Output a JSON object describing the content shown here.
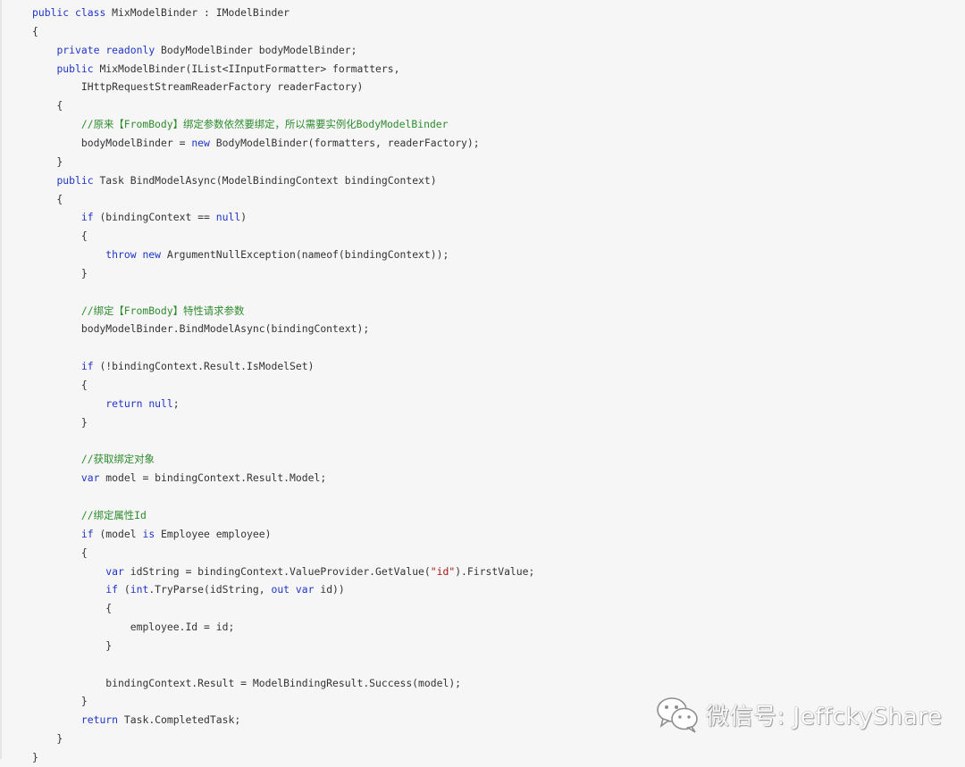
{
  "code": {
    "lines": [
      [
        [
          "kw",
          "public"
        ],
        [
          "p",
          " "
        ],
        [
          "kw",
          "class"
        ],
        [
          "p",
          " MixModelBinder : IModelBinder"
        ]
      ],
      [
        [
          "p",
          "{"
        ]
      ],
      [
        [
          "p",
          "    "
        ],
        [
          "kw",
          "private"
        ],
        [
          "p",
          " "
        ],
        [
          "kw",
          "readonly"
        ],
        [
          "p",
          " BodyModelBinder bodyModelBinder;"
        ]
      ],
      [
        [
          "p",
          "    "
        ],
        [
          "kw",
          "public"
        ],
        [
          "p",
          " MixModelBinder(IList<IInputFormatter> formatters,"
        ]
      ],
      [
        [
          "p",
          "        IHttpRequestStreamReaderFactory readerFactory)"
        ]
      ],
      [
        [
          "p",
          "    {"
        ]
      ],
      [
        [
          "p",
          "        "
        ],
        [
          "cm",
          "//原来【FromBody】绑定参数依然要绑定，所以需要实例化BodyModelBinder"
        ]
      ],
      [
        [
          "p",
          "        bodyModelBinder = "
        ],
        [
          "kw",
          "new"
        ],
        [
          "p",
          " BodyModelBinder(formatters, readerFactory);"
        ]
      ],
      [
        [
          "p",
          "    }"
        ]
      ],
      [
        [
          "p",
          "    "
        ],
        [
          "kw",
          "public"
        ],
        [
          "p",
          " Task BindModelAsync(ModelBindingContext bindingContext)"
        ]
      ],
      [
        [
          "p",
          "    {"
        ]
      ],
      [
        [
          "p",
          "        "
        ],
        [
          "kw",
          "if"
        ],
        [
          "p",
          " (bindingContext == "
        ],
        [
          "kw",
          "null"
        ],
        [
          "p",
          ")"
        ]
      ],
      [
        [
          "p",
          "        {"
        ]
      ],
      [
        [
          "p",
          "            "
        ],
        [
          "kw",
          "throw"
        ],
        [
          "p",
          " "
        ],
        [
          "kw",
          "new"
        ],
        [
          "p",
          " ArgumentNullException(nameof(bindingContext));"
        ]
      ],
      [
        [
          "p",
          "        }"
        ]
      ],
      [],
      [
        [
          "p",
          "        "
        ],
        [
          "cm",
          "//绑定【FromBody】特性请求参数"
        ]
      ],
      [
        [
          "p",
          "        bodyModelBinder.BindModelAsync(bindingContext);"
        ]
      ],
      [],
      [
        [
          "p",
          "        "
        ],
        [
          "kw",
          "if"
        ],
        [
          "p",
          " (!bindingContext.Result.IsModelSet)"
        ]
      ],
      [
        [
          "p",
          "        {"
        ]
      ],
      [
        [
          "p",
          "            "
        ],
        [
          "kw",
          "return"
        ],
        [
          "p",
          " "
        ],
        [
          "kw",
          "null"
        ],
        [
          "p",
          ";"
        ]
      ],
      [
        [
          "p",
          "        }"
        ]
      ],
      [],
      [
        [
          "p",
          "        "
        ],
        [
          "cm",
          "//获取绑定对象"
        ]
      ],
      [
        [
          "p",
          "        "
        ],
        [
          "kw",
          "var"
        ],
        [
          "p",
          " model = bindingContext.Result.Model;"
        ]
      ],
      [],
      [
        [
          "p",
          "        "
        ],
        [
          "cm",
          "//绑定属性Id"
        ]
      ],
      [
        [
          "p",
          "        "
        ],
        [
          "kw",
          "if"
        ],
        [
          "p",
          " (model "
        ],
        [
          "kw",
          "is"
        ],
        [
          "p",
          " Employee employee)"
        ]
      ],
      [
        [
          "p",
          "        {"
        ]
      ],
      [
        [
          "p",
          "            "
        ],
        [
          "kw",
          "var"
        ],
        [
          "p",
          " idString = bindingContext.ValueProvider.GetValue("
        ],
        [
          "str",
          "\"id\""
        ],
        [
          "p",
          ").FirstValue;"
        ]
      ],
      [
        [
          "p",
          "            "
        ],
        [
          "kw",
          "if"
        ],
        [
          "p",
          " ("
        ],
        [
          "kw",
          "int"
        ],
        [
          "p",
          ".TryParse(idString, "
        ],
        [
          "kw",
          "out"
        ],
        [
          "p",
          " "
        ],
        [
          "kw",
          "var"
        ],
        [
          "p",
          " id))"
        ]
      ],
      [
        [
          "p",
          "            {"
        ]
      ],
      [
        [
          "p",
          "                employee.Id = id;"
        ]
      ],
      [
        [
          "p",
          "            }"
        ]
      ],
      [],
      [
        [
          "p",
          "            bindingContext.Result = ModelBindingResult.Success(model);"
        ]
      ],
      [
        [
          "p",
          "        }"
        ]
      ],
      [
        [
          "p",
          "        "
        ],
        [
          "kw",
          "return"
        ],
        [
          "p",
          " Task.CompletedTask;"
        ]
      ],
      [
        [
          "p",
          "    }"
        ]
      ],
      [
        [
          "p",
          "}"
        ]
      ]
    ]
  },
  "watermark": {
    "icon": "wechat-icon",
    "text": "微信号: JeffckyShare"
  },
  "colors": {
    "keyword": "#1f35c8",
    "comment": "#2e8b2e",
    "string": "#a31515",
    "plain": "#333333",
    "background": "#f6f6f6"
  }
}
